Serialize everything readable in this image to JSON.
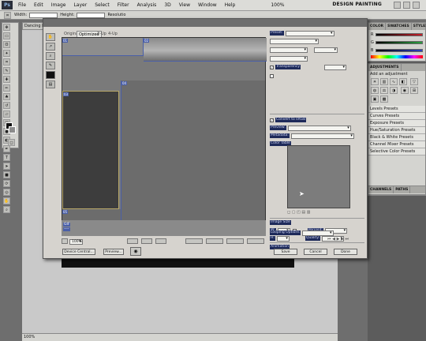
{
  "menubar": {
    "logo": "Ps",
    "items": [
      "File",
      "Edit",
      "Image",
      "Layer",
      "Select",
      "Filter",
      "Analysis",
      "3D",
      "View",
      "Window",
      "Help"
    ],
    "zoom": "100%",
    "workspace": "DESIGN PAINTING"
  },
  "optionsbar": {
    "width_label": "Width:",
    "height_label": "Height:",
    "resolution_label": "Resolutio"
  },
  "document": {
    "tab_title": "Dancing La",
    "status_zoom": "100%"
  },
  "dialog": {
    "tabs": [
      "Original",
      "Optimized",
      "2-Up",
      "4-Up"
    ],
    "active_tab": "Optimized",
    "zoom_value": "100%",
    "color_table_label": "Color Table",
    "buttons": {
      "preview": "Device Central...",
      "preview2": "Preview...",
      "save": "Save",
      "cancel": "Cancel",
      "done": "Done"
    }
  },
  "panels": {
    "color_tabs": [
      "COLOR",
      "SWATCHES",
      "STYLES"
    ],
    "adjust_tab": "ADJUSTMENTS",
    "adjust_title": "Add an adjustment",
    "presets": [
      "Levels Presets",
      "Curves Presets",
      "Exposure Presets",
      "Hue/Saturation Presets",
      "Black & White Presets",
      "Channel Mixer Presets",
      "Selective Color Presets"
    ],
    "bottom_tabs": [
      "CHANNELS",
      "PATHS"
    ],
    "colors": {
      "grad_r": "#c8202a",
      "grad_g": "#2aa040",
      "grad_b": "#2a40c8"
    }
  }
}
